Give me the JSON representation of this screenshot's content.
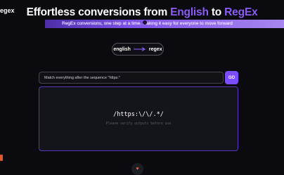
{
  "app": {
    "logo_text": "egex"
  },
  "headline": {
    "part1": "Effortless conversions from ",
    "from_lang": "English",
    "part2": " to ",
    "to_lang": "RegEx"
  },
  "banner": {
    "text": "RegEx conversions, one step at a time. Making it easy for everyone to move forward",
    "icon": "dot-icon"
  },
  "language_pill": {
    "from": "english",
    "to": "regex",
    "icon": "arrow-right-icon"
  },
  "converter": {
    "input_value": "Match everything after the sequence \"https:\"",
    "go_label": "GO",
    "output_regex": "/https:\\/\\/.*/",
    "verify_note": "Please verify outputs before use"
  },
  "colors": {
    "accent": "#8b5cf6",
    "button": "#7c4dff",
    "background": "#0a0a0f"
  },
  "footer": {
    "icon": "heart-icon",
    "glyph": "♥"
  }
}
